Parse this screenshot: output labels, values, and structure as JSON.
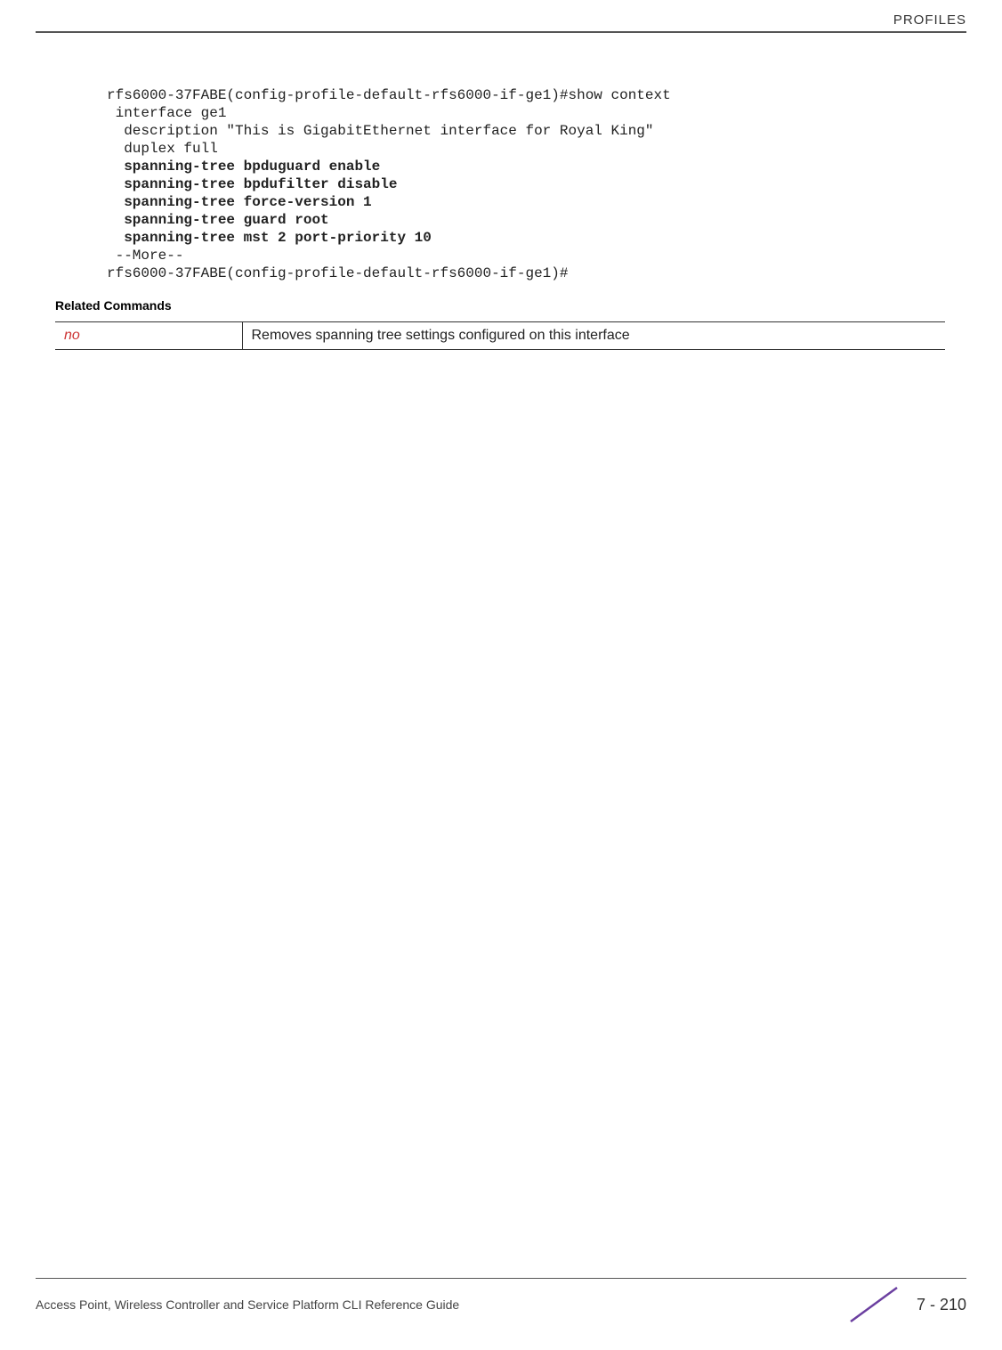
{
  "header": {
    "title": "PROFILES"
  },
  "code": {
    "l1": "rfs6000-37FABE(config-profile-default-rfs6000-if-ge1)#show context",
    "l2": " interface ge1",
    "l3": "  description \"This is GigabitEthernet interface for Royal King\"",
    "l4": "  duplex full",
    "l5": "  spanning-tree bpduguard enable",
    "l6": "  spanning-tree bpdufilter disable",
    "l7": "  spanning-tree force-version 1",
    "l8": "  spanning-tree guard root",
    "l9": "  spanning-tree mst 2 port-priority 10",
    "l10": " --More--",
    "l11": "rfs6000-37FABE(config-profile-default-rfs6000-if-ge1)#"
  },
  "section": {
    "related_label": "Related Commands"
  },
  "table": {
    "cmd": "no",
    "desc": "Removes spanning tree settings configured on this interface"
  },
  "footer": {
    "left": "Access Point, Wireless Controller and Service Platform CLI Reference Guide",
    "page": "7 - 210"
  }
}
